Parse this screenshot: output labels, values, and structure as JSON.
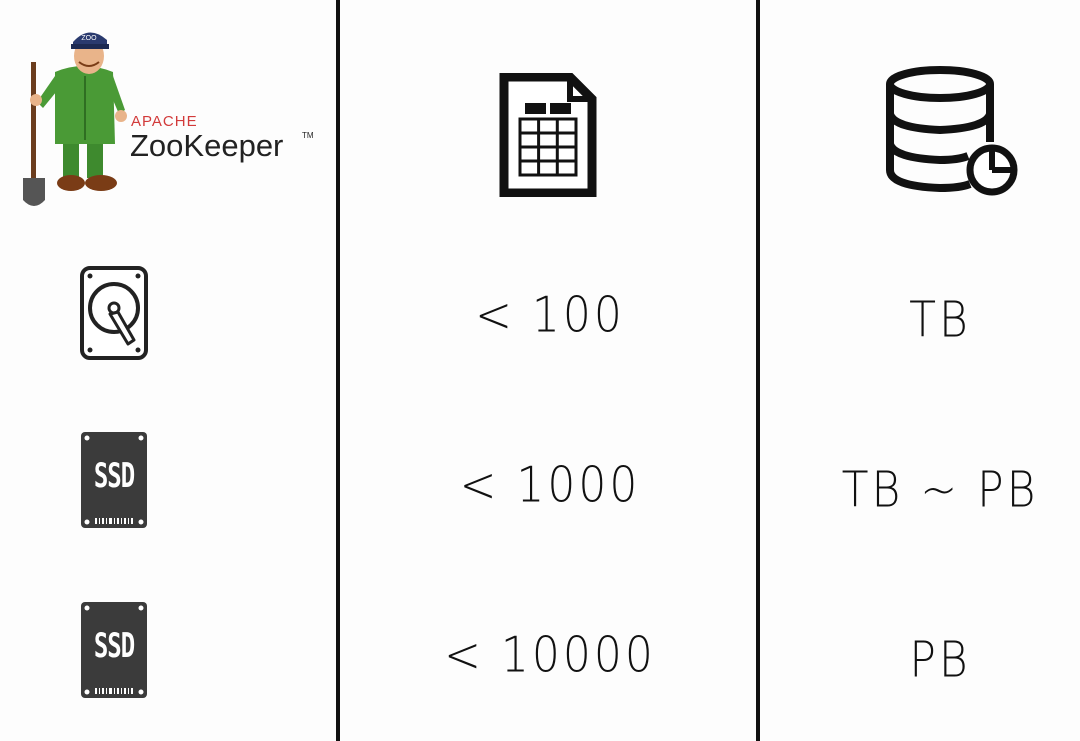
{
  "logo": {
    "vendor": "APACHE",
    "product": "ZooKeeper",
    "trademark": "TM",
    "hat_text": "ZOO"
  },
  "columns": [
    {
      "name": "storage-type",
      "header_icon": "zookeeper-logo"
    },
    {
      "name": "table-count",
      "header_icon": "table-file-icon"
    },
    {
      "name": "data-volume",
      "header_icon": "database-chart-icon"
    }
  ],
  "rows": [
    {
      "storage_icon": "hard-disk-icon",
      "storage_label": "",
      "count": "< 100",
      "volume": "TB"
    },
    {
      "storage_icon": "ssd-icon",
      "storage_label": "SSD",
      "count": "< 1000",
      "volume": "TB ~ PB"
    },
    {
      "storage_icon": "ssd-icon",
      "storage_label": "SSD",
      "count": "< 10000",
      "volume": "PB"
    }
  ]
}
